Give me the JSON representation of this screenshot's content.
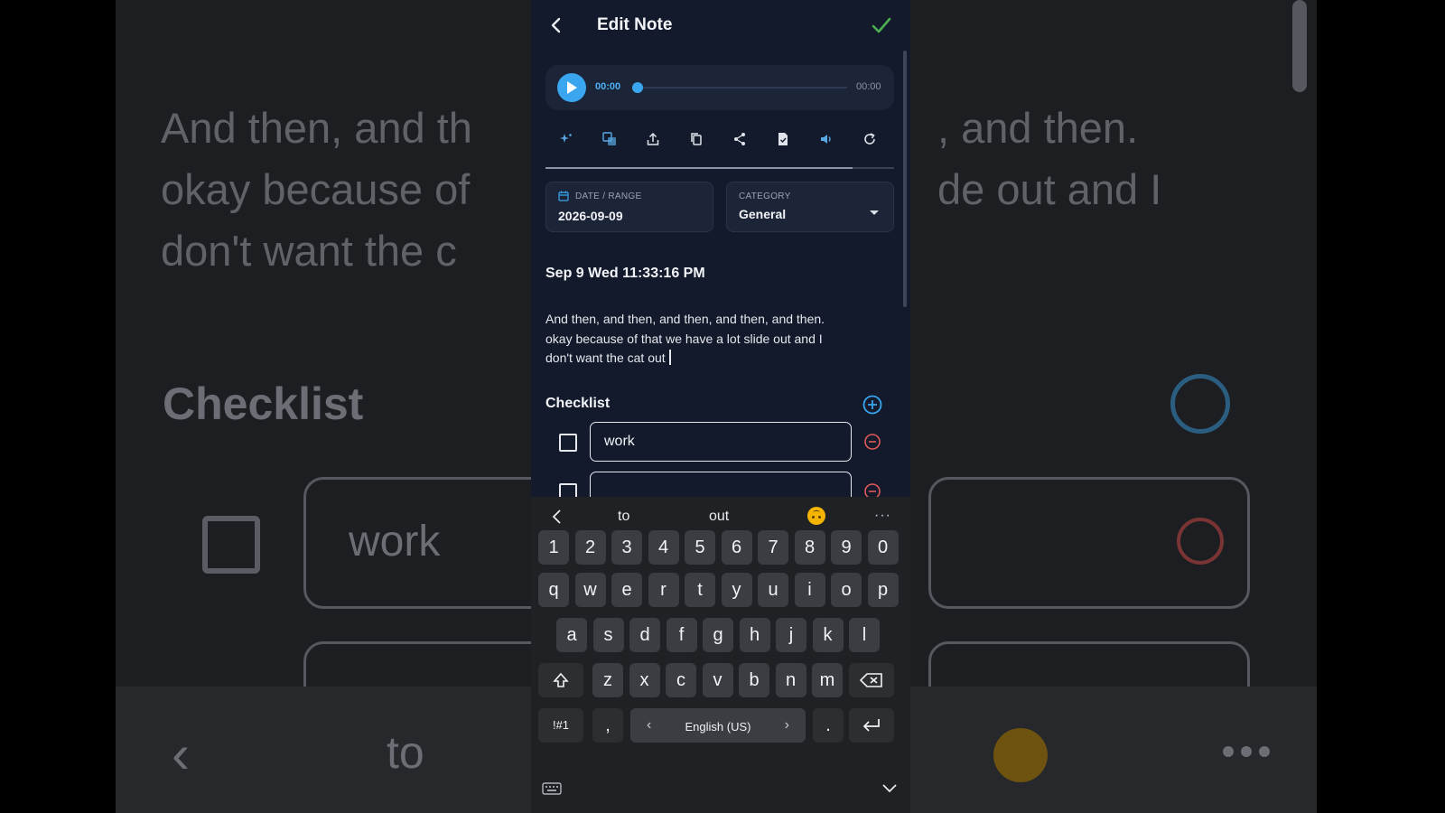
{
  "background_mirror": {
    "text_lines": [
      "And then, and th",
      "okay because of",
      "don't want the c"
    ],
    "text_lines_right": [
      ", and then.",
      "de out and I"
    ],
    "checklist_title": "Checklist",
    "item": "work",
    "sugg_to": "to"
  },
  "appbar": {
    "title": "Edit Note"
  },
  "player": {
    "current_time": "00:00",
    "duration": "00:00",
    "progress": 0
  },
  "toolbar": {
    "icons": [
      "sparkle-icon",
      "translate-icon",
      "export-icon",
      "copy-icon",
      "share-icon",
      "document-icon",
      "speaker-icon",
      "refresh-icon"
    ]
  },
  "fields": {
    "date": {
      "label": "DATE / RANGE",
      "value": "2026-09-09"
    },
    "category": {
      "label": "CATEGORY",
      "value": "General"
    }
  },
  "note": {
    "datetime": "Sep 9 Wed 11:33:16 PM",
    "body_lines": [
      "And then, and then, and then, and then, and then.",
      "okay because of that we have a lot slide out and I",
      "don't want the cat out"
    ]
  },
  "checklist": {
    "title": "Checklist",
    "items": [
      {
        "text": "work",
        "checked": false
      },
      {
        "text": "",
        "checked": false
      }
    ]
  },
  "keyboard": {
    "suggestions": [
      "to",
      "out"
    ],
    "more": "···",
    "row_numbers": [
      "1",
      "2",
      "3",
      "4",
      "5",
      "6",
      "7",
      "8",
      "9",
      "0"
    ],
    "row1": [
      "q",
      "w",
      "e",
      "r",
      "t",
      "y",
      "u",
      "i",
      "o",
      "p"
    ],
    "row2": [
      "a",
      "s",
      "d",
      "f",
      "g",
      "h",
      "j",
      "k",
      "l"
    ],
    "row3": [
      "z",
      "x",
      "c",
      "v",
      "b",
      "n",
      "m"
    ],
    "symbols_key": "!#1",
    "comma_key": ",",
    "language": "English (US)",
    "period_key": "."
  },
  "colors": {
    "accent": "#3aa6ef",
    "confirm": "#4caf50",
    "remove": "#e05a5a",
    "surface": "#121a2b"
  }
}
